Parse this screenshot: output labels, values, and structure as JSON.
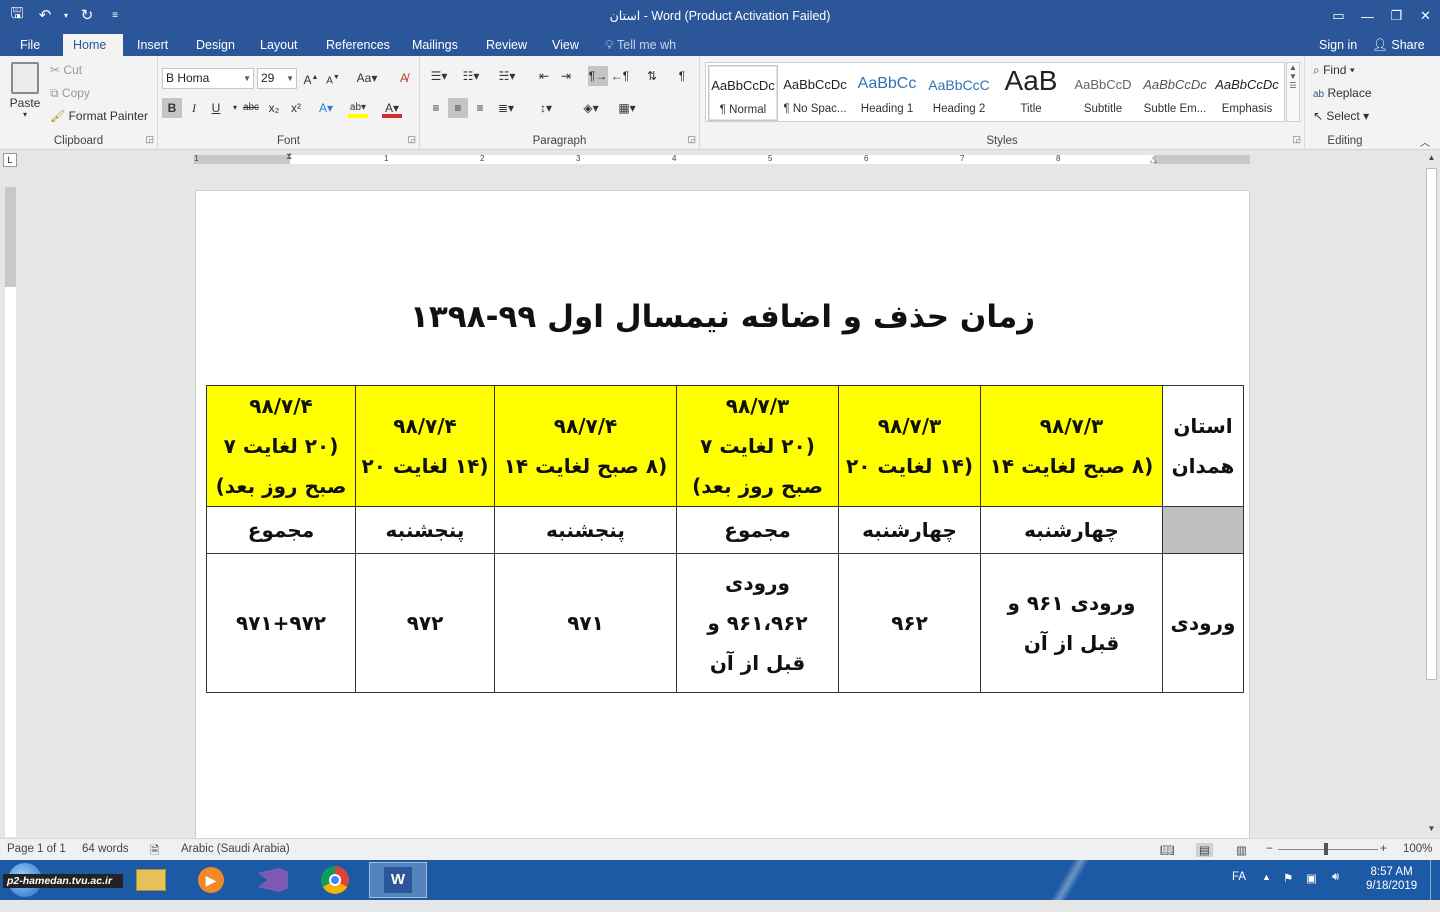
{
  "window": {
    "title": "استان - Word (Product Activation Failed)",
    "controls": {
      "ribbon_display": "▭",
      "minimize": "—",
      "restore": "❐",
      "close": "✕"
    }
  },
  "qat": {
    "save": "save-icon",
    "undo": "undo-icon",
    "redo": "redo-icon"
  },
  "tabs": [
    "File",
    "Home",
    "Insert",
    "Design",
    "Layout",
    "References",
    "Mailings",
    "Review",
    "View"
  ],
  "tell_me": "Tell me wh",
  "account": {
    "signin": "Sign in",
    "share": "Share"
  },
  "clipboard": {
    "paste": "Paste",
    "cut": "Cut",
    "copy": "Copy",
    "format_painter": "Format Painter",
    "label": "Clipboard"
  },
  "font": {
    "name": "B Homa",
    "size": "29",
    "label": "Font",
    "bold": "B",
    "italic": "I",
    "underline": "U",
    "strike": "abc",
    "sub": "x₂",
    "sup": "x²",
    "case": "Aa"
  },
  "paragraph": {
    "label": "Paragraph"
  },
  "styles": {
    "label": "Styles",
    "items": [
      {
        "sample": "AaBbCcDc",
        "name": "¶ Normal"
      },
      {
        "sample": "AaBbCcDc",
        "name": "¶ No Spac..."
      },
      {
        "sample": "AaBbCc",
        "name": "Heading 1"
      },
      {
        "sample": "AaBbCcC",
        "name": "Heading 2"
      },
      {
        "sample": "AaB",
        "name": "Title"
      },
      {
        "sample": "AaBbCcD",
        "name": "Subtitle"
      },
      {
        "sample": "AaBbCcDc",
        "name": "Subtle Em..."
      },
      {
        "sample": "AaBbCcDc",
        "name": "Emphasis"
      }
    ]
  },
  "editing": {
    "find": "Find",
    "replace": "Replace",
    "select": "Select",
    "label": "Editing"
  },
  "ruler": {
    "numbers": [
      "1",
      "1",
      "2",
      "3",
      "4",
      "5",
      "6",
      "7",
      "8"
    ]
  },
  "document": {
    "title": "زمان حذف و اضافه نیمسال اول ۹۹-۱۳۹۸",
    "table": {
      "corner": [
        "استان",
        "همدان"
      ],
      "date_cols": [
        [
          "۹۸/۷/۳",
          "(۸ صبح لغایت ۱۴"
        ],
        [
          "۹۸/۷/۳",
          "(۱۴ لغایت ۲۰"
        ],
        [
          "۹۸/۷/۳",
          "(۲۰ لغایت ۷",
          "صبح روز بعد)"
        ],
        [
          "۹۸/۷/۴",
          "(۸ صبح لغایت ۱۴"
        ],
        [
          "۹۸/۷/۴",
          "(۱۴ لغایت ۲۰"
        ],
        [
          "۹۸/۷/۴",
          "(۲۰ لغایت ۷",
          "صبح روز بعد)"
        ]
      ],
      "days": [
        "چهارشنبه",
        "چهارشنبه",
        "مجموع",
        "پنجشنبه",
        "پنجشنبه",
        "مجموع"
      ],
      "row_label": "ورودی",
      "entries": [
        [
          "ورودی ۹۶۱ و",
          "قبل از آن"
        ],
        [
          "۹۶۲"
        ],
        [
          "ورودی",
          "۹۶۱،۹۶۲ و",
          "قبل از آن"
        ],
        [
          "۹۷۱"
        ],
        [
          "۹۷۲"
        ],
        [
          "۹۷۱+۹۷۲"
        ]
      ]
    }
  },
  "status": {
    "page": "Page 1 of 1",
    "words": "64 words",
    "language": "Arabic (Saudi Arabia)",
    "zoom": "100%"
  },
  "taskbar": {
    "start_label": "p2-hamedan.tvu.ac.ir",
    "apps": [
      "file-explorer-icon",
      "media-player-icon",
      "visual-studio-icon",
      "chrome-icon",
      "word-icon"
    ],
    "lang": "FA",
    "time": "8:57 AM",
    "date": "9/18/2019"
  },
  "colors": {
    "brand": "#2b579a",
    "highlight": "#ffff00",
    "gray_cell": "#bfbfbf",
    "taskbar": "#1d5aa6"
  }
}
